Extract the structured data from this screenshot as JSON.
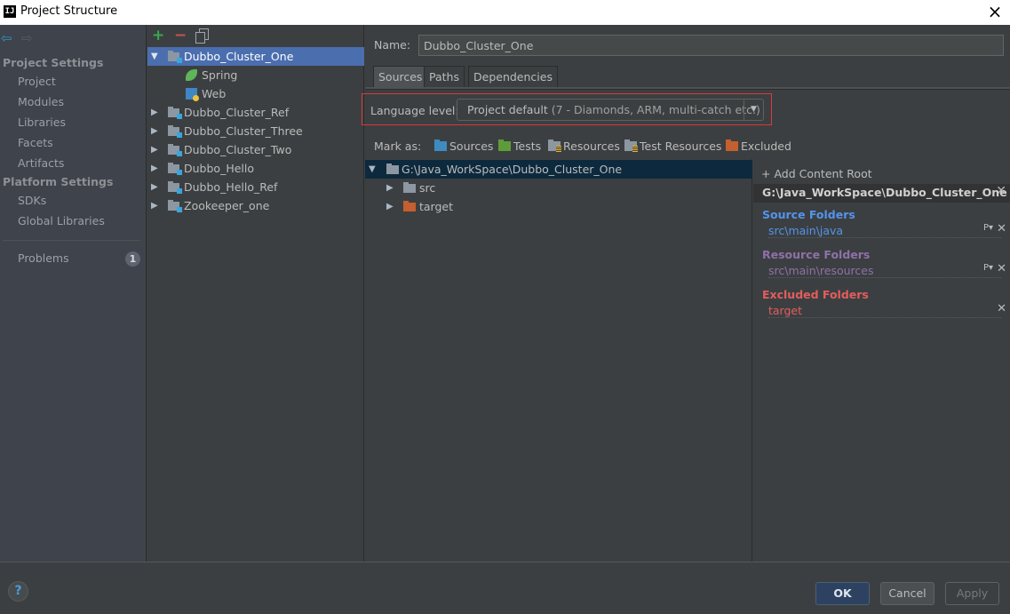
{
  "window": {
    "title": "Project Structure",
    "logo": "IJ",
    "close_icon": "×"
  },
  "sidebar": {
    "back_icon": "⇦",
    "forward_icon": "⇨",
    "sections": [
      {
        "title": "Project Settings",
        "items": [
          "Project",
          "Modules",
          "Libraries",
          "Facets",
          "Artifacts"
        ]
      },
      {
        "title": "Platform Settings",
        "items": [
          "SDKs",
          "Global Libraries"
        ]
      }
    ],
    "problems": {
      "label": "Problems",
      "count": "1"
    }
  },
  "module_tree": {
    "toolbar": {
      "add": "+",
      "remove": "−"
    },
    "modules": [
      {
        "name": "Dubbo_Cluster_One",
        "expanded": true,
        "selected": true,
        "children": [
          {
            "name": "Spring",
            "icon": "spring-icon"
          },
          {
            "name": "Web",
            "icon": "web-icon"
          }
        ]
      },
      {
        "name": "Dubbo_Cluster_Ref"
      },
      {
        "name": "Dubbo_Cluster_Three"
      },
      {
        "name": "Dubbo_Cluster_Two"
      },
      {
        "name": "Dubbo_Hello"
      },
      {
        "name": "Dubbo_Hello_Ref"
      },
      {
        "name": "Zookeeper_one"
      }
    ],
    "expanded_arrow": "▼",
    "collapsed_arrow": "▶"
  },
  "content": {
    "name_label": "Name:",
    "name_value": "Dubbo_Cluster_One",
    "tabs": [
      "Sources",
      "Paths",
      "Dependencies"
    ],
    "active_tab": "Sources",
    "language_level": {
      "label": "Language level:",
      "value": "Project default",
      "value_detail": "(7 - Diamonds, ARM, multi-catch etc.)",
      "dropdown_icon": "▼"
    },
    "mark_as": {
      "label": "Mark as:",
      "items": [
        "Sources",
        "Tests",
        "Resources",
        "Test Resources",
        "Excluded"
      ]
    },
    "file_tree": {
      "root": "G:\\Java_WorkSpace\\Dubbo_Cluster_One",
      "children": [
        "src",
        "target"
      ]
    },
    "content_root": {
      "add_label": "+ Add Content Root",
      "path": "G:\\Java_WorkSpace\\Dubbo_Cluster_One",
      "groups": [
        {
          "title": "Source Folders",
          "color": "#5394ec",
          "items": [
            "src\\main\\java"
          ],
          "has_props": true
        },
        {
          "title": "Resource Folders",
          "color": "#8e71a8",
          "items": [
            "src\\main\\resources"
          ],
          "has_props": true
        },
        {
          "title": "Excluded Folders",
          "color": "#e35d5d",
          "items": [
            "target"
          ],
          "has_props": false
        }
      ],
      "remove_icon": "✕",
      "props_icon": "P▾"
    }
  },
  "footer": {
    "help_icon": "?",
    "ok": "OK",
    "cancel": "Cancel",
    "apply": "Apply"
  }
}
